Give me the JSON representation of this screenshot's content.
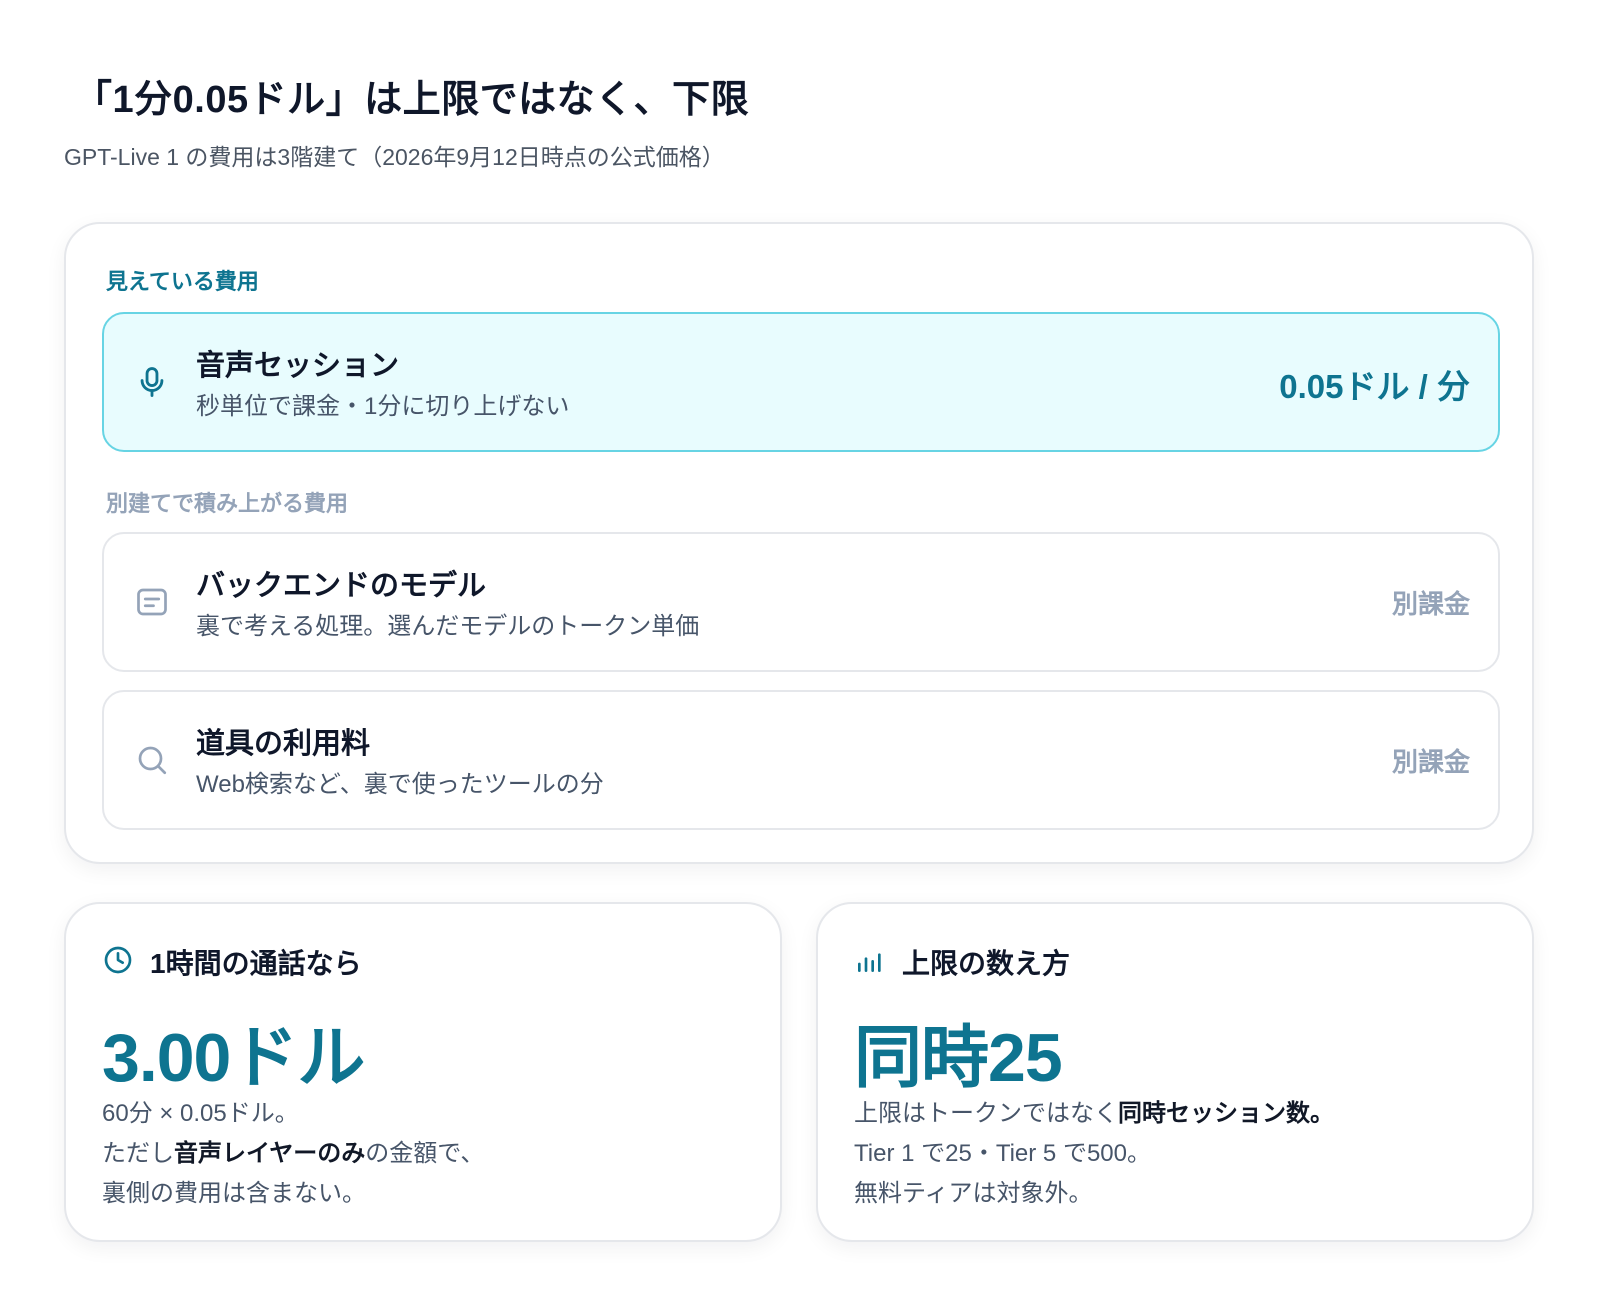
{
  "header": {
    "title": "「1分0.05ドル」は上限ではなく、下限",
    "subtitle": "GPT-Live 1 の費用は3階建て（2026年9月12日時点の公式価格）"
  },
  "main_card": {
    "visible_label": "見えている費用",
    "stacked_label": "別建てで積み上がる費用",
    "rows": [
      {
        "icon": "microphone-icon",
        "title": "音声セッション",
        "desc": "秒単位で課金・1分に切り上げない",
        "price": "0.05ドル / 分"
      },
      {
        "icon": "document-icon",
        "title": "バックエンドのモデル",
        "desc": "裏で考える処理。選んだモデルのトークン単価",
        "badge": "別課金"
      },
      {
        "icon": "search-icon",
        "title": "道具の利用料",
        "desc": "Web検索など、裏で使ったツールの分",
        "badge": "別課金"
      }
    ]
  },
  "cards": {
    "hour": {
      "icon": "clock-icon",
      "label": "1時間の通話なら",
      "value": "3.00ドル",
      "line1": "60分 × 0.05ドル。",
      "line2_pre": "ただし",
      "line2_bold": "音声レイヤーのみ",
      "line2_post": "の金額で、",
      "line3": "裏側の費用は含まない。"
    },
    "limit": {
      "icon": "bar-chart-icon",
      "label": "上限の数え方",
      "value": "同時25",
      "line1_pre": "上限はトークンではなく",
      "line1_bold": "同時セッション数。",
      "line2": "Tier 1 で25・Tier 5 で500。",
      "line3": "無料ティアは対象外。"
    }
  },
  "colors": {
    "accent": "#0e7490",
    "highlight_bg": "#e8fcfe",
    "highlight_border": "#67d4e4",
    "muted": "#94a3b8",
    "border": "#e5e7eb"
  }
}
